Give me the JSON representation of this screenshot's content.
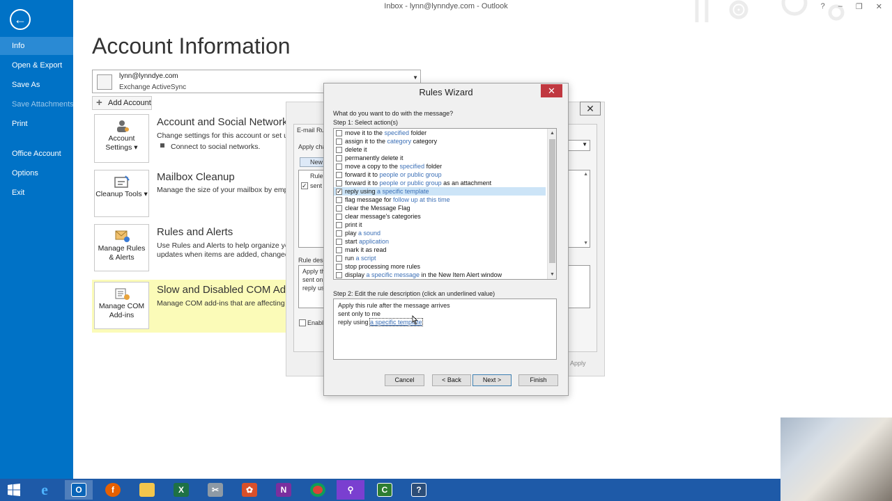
{
  "window": {
    "title": "Inbox - lynn@lynndye.com - Outlook",
    "controls": [
      "?",
      "–",
      "❐",
      "✕"
    ]
  },
  "nav": {
    "items": [
      {
        "label": "Info",
        "active": true
      },
      {
        "label": "Open & Export"
      },
      {
        "label": "Save As"
      },
      {
        "label": "Save Attachments",
        "disabled": true
      },
      {
        "label": "Print"
      },
      {
        "label": "Office Account"
      },
      {
        "label": "Options"
      },
      {
        "label": "Exit"
      }
    ]
  },
  "page": {
    "title": "Account Information"
  },
  "account": {
    "email": "lynn@lynndye.com",
    "type": "Exchange ActiveSync",
    "add_label": "Add Account"
  },
  "sections": [
    {
      "tile": "Account Settings ▾",
      "title": "Account and Social Network",
      "desc1": "Change settings for this account or set up",
      "desc2": "Connect to social networks."
    },
    {
      "tile": "Cleanup Tools ▾",
      "title": "Mailbox Cleanup",
      "desc1": "Manage the size of your mailbox by empty"
    },
    {
      "tile": "Manage Rules & Alerts",
      "title": "Rules and Alerts",
      "desc1": "Use Rules and Alerts to help organize you",
      "desc2": "updates when items are added, changed, o"
    },
    {
      "tile": "Manage COM Add-ins",
      "title": "Slow and Disabled COM Add",
      "desc1": "Manage COM add-ins that are affecting yo"
    }
  ],
  "bg_dialog": {
    "tab": "E-mail Ru",
    "apply_changes": "Apply cha",
    "new_btn": "New",
    "rule_header": "Rule",
    "rule_item": "sent",
    "rule_desc_label": "Rule desc",
    "rule_desc_lines": [
      "Apply th",
      "sent on",
      "reply us"
    ],
    "enable_label": "Enabl",
    "apply_label": "Apply"
  },
  "wizard": {
    "title": "Rules Wizard",
    "question": "What do you want to do with the message?",
    "step1": "Step 1: Select action(s)",
    "actions": [
      {
        "pre": "move it to the ",
        "link": "specified",
        "post": " folder",
        "checked": false
      },
      {
        "pre": "assign it to the ",
        "link": "category",
        "post": " category",
        "checked": false
      },
      {
        "pre": "delete it",
        "link": "",
        "post": "",
        "checked": false
      },
      {
        "pre": "permanently delete it",
        "link": "",
        "post": "",
        "checked": false
      },
      {
        "pre": "move a copy to the ",
        "link": "specified",
        "post": " folder",
        "checked": false
      },
      {
        "pre": "forward it to ",
        "link": "people or public group",
        "post": "",
        "checked": false
      },
      {
        "pre": "forward it to ",
        "link": "people or public group",
        "post": " as an attachment",
        "checked": false
      },
      {
        "pre": "reply using ",
        "link": "a specific template",
        "post": "",
        "checked": true
      },
      {
        "pre": "flag message for ",
        "link": "follow up at this time",
        "post": "",
        "checked": false
      },
      {
        "pre": "clear the Message Flag",
        "link": "",
        "post": "",
        "checked": false
      },
      {
        "pre": "clear message's categories",
        "link": "",
        "post": "",
        "checked": false
      },
      {
        "pre": "print it",
        "link": "",
        "post": "",
        "checked": false
      },
      {
        "pre": "play ",
        "link": "a sound",
        "post": "",
        "checked": false
      },
      {
        "pre": "start ",
        "link": "application",
        "post": "",
        "checked": false
      },
      {
        "pre": "mark it as read",
        "link": "",
        "post": "",
        "checked": false
      },
      {
        "pre": "run ",
        "link": "a script",
        "post": "",
        "checked": false
      },
      {
        "pre": "stop processing more rules",
        "link": "",
        "post": "",
        "checked": false
      },
      {
        "pre": "display ",
        "link": "a specific message",
        "post": " in the New Item Alert window",
        "checked": false
      }
    ],
    "step2": "Step 2: Edit the rule description (click an underlined value)",
    "desc_lines": [
      {
        "pre": "Apply this rule after the message arrives",
        "link": ""
      },
      {
        "pre": "sent only to me",
        "link": ""
      },
      {
        "pre": "reply using ",
        "link": "a specific template"
      }
    ],
    "buttons": {
      "cancel": "Cancel",
      "back": "< Back",
      "next": "Next >",
      "finish": "Finish"
    }
  },
  "taskbar": {
    "icons": [
      "windows-start",
      "internet-explorer",
      "outlook",
      "firefox",
      "file-explorer",
      "excel",
      "snipping-tool",
      "app-orange",
      "onenote",
      "chrome",
      "magnifier",
      "camtasia",
      "help"
    ]
  }
}
